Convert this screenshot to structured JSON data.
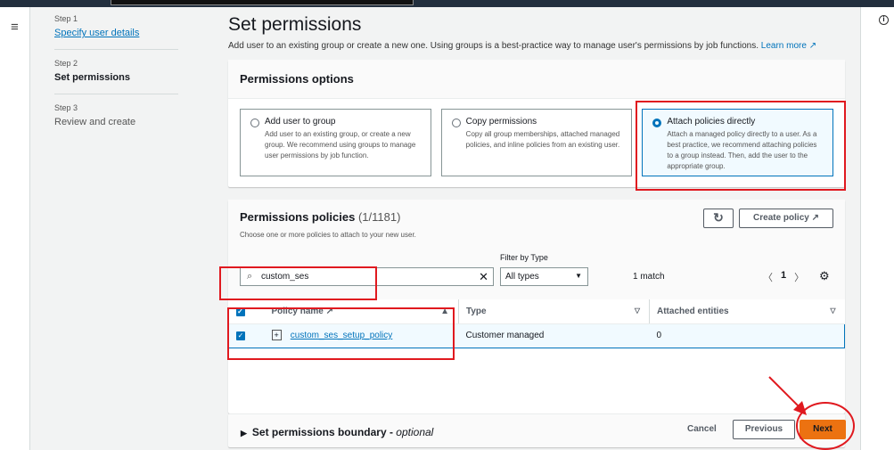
{
  "icons": {
    "menu": "hamburger-icon",
    "info": "info-icon",
    "search": "search-icon",
    "clear": "close-icon",
    "refresh": "refresh-icon",
    "external": "external-link-icon",
    "settings": "gear-icon"
  },
  "colors": {
    "accent": "#0073bb",
    "primary_button": "#ec7211",
    "annotation": "#e0191f"
  },
  "steps": [
    {
      "num": "Step 1",
      "label": "Specify user details"
    },
    {
      "num": "Step 2",
      "label": "Set permissions"
    },
    {
      "num": "Step 3",
      "label": "Review and create"
    }
  ],
  "header": {
    "title": "Set permissions",
    "description": "Add user to an existing group or create a new one. Using groups is a best-practice way to manage user's permissions by job functions.",
    "learn_more": "Learn more ↗"
  },
  "options": {
    "title": "Permissions options",
    "items": [
      {
        "label": "Add user to group",
        "desc": "Add user to an existing group, or create a new group. We recommend using groups to manage user permissions by job function.",
        "selected": false
      },
      {
        "label": "Copy permissions",
        "desc": "Copy all group memberships, attached managed policies, and inline policies from an existing user.",
        "selected": false
      },
      {
        "label": "Attach policies directly",
        "desc": "Attach a managed policy directly to a user. As a best practice, we recommend attaching policies to a group instead. Then, add the user to the appropriate group.",
        "selected": true
      }
    ]
  },
  "policies": {
    "title": "Permissions policies",
    "count": "(1/1181)",
    "subtitle": "Choose one or more policies to attach to your new user.",
    "create_policy": "Create policy ↗",
    "refresh": "↻",
    "search_value": "custom_ses",
    "filter_label": "Filter by Type",
    "filter_value": "All types",
    "match": "1 match",
    "page": "1",
    "columns": [
      "Policy name ↗",
      "Type",
      "Attached entities"
    ],
    "rows": [
      {
        "name": "custom_ses_setup_policy",
        "type": "Customer managed",
        "attached": "0",
        "checked": true
      }
    ]
  },
  "boundary": {
    "title": "Set permissions boundary - ",
    "optional": "optional"
  },
  "footer": {
    "cancel": "Cancel",
    "previous": "Previous",
    "next": "Next"
  }
}
